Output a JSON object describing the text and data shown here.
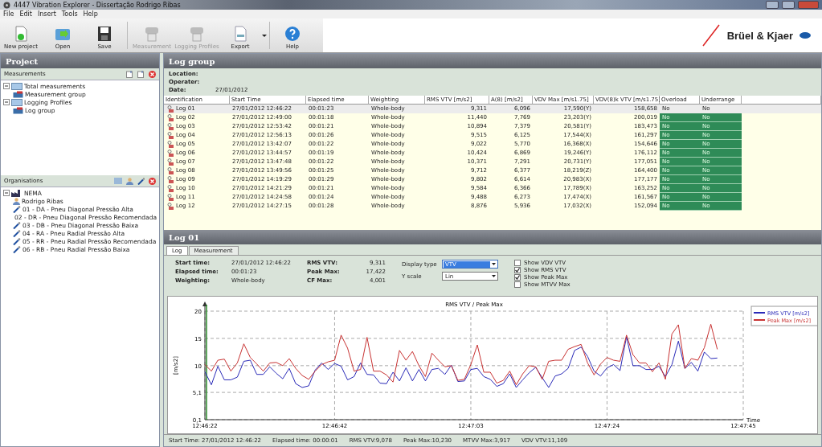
{
  "window": {
    "title": "4447 Vibration Explorer - Dissertação Rodrigo Ribas"
  },
  "menu": [
    "File",
    "Edit",
    "Insert",
    "Tools",
    "Help"
  ],
  "toolbar": [
    {
      "label": "New project",
      "kind": "new",
      "disabled": false
    },
    {
      "label": "Open",
      "kind": "open",
      "disabled": false
    },
    {
      "label": "Save",
      "kind": "save",
      "disabled": false
    },
    {
      "label": "Measurement",
      "kind": "device",
      "disabled": true
    },
    {
      "label": "Logging Profiles",
      "kind": "device",
      "disabled": true
    },
    {
      "label": "Export",
      "kind": "export",
      "disabled": false
    },
    {
      "label": "Help",
      "kind": "help",
      "disabled": false
    }
  ],
  "brand": "Brüel & Kjaer",
  "project": {
    "title": "Project",
    "measurements": {
      "title": "Measurements",
      "items": [
        {
          "label": "Total measurements",
          "kind": "folder",
          "expanded": true,
          "children": [
            {
              "label": "Measurement group",
              "kind": "group"
            }
          ]
        },
        {
          "label": "Logging Profiles",
          "kind": "folder",
          "expanded": true,
          "children": [
            {
              "label": "Log group",
              "kind": "group"
            }
          ]
        }
      ]
    },
    "organisations": {
      "title": "Organisations",
      "items": [
        {
          "label": "NEMA",
          "kind": "org",
          "expanded": true,
          "children": [
            {
              "label": "Rodrigo Ribas",
              "kind": "person"
            },
            {
              "label": "01 - DA - Pneu Diagonal Pressão Alta",
              "kind": "tool"
            },
            {
              "label": "02 - DR - Pneu Diagonal Pressão Recomendada",
              "kind": "tool"
            },
            {
              "label": "03 - DB - Pneu Diagonal Pressão Baixa",
              "kind": "tool"
            },
            {
              "label": "04 - RA - Pneu Radial Pressão Alta",
              "kind": "tool"
            },
            {
              "label": "05 - RR - Pneu Radial Pressão Recomendada",
              "kind": "tool"
            },
            {
              "label": "06 - RB - Pneu Radial Pressão Baixa",
              "kind": "tool"
            }
          ]
        }
      ]
    }
  },
  "log_group": {
    "title": "Log group",
    "info": [
      {
        "label": "Location:"
      },
      {
        "label": "Operater:"
      },
      {
        "label": "Date:",
        "value": "27/01/2012"
      }
    ],
    "table": {
      "columns": [
        "Identification",
        "Start Time",
        "Elapsed time",
        "Weighting",
        "RMS VTV [m/s2]",
        "A(8) [m/s2]",
        "VDV Max [m/s1.75]",
        "VDV(8)k VTV [m/s1.75]",
        "Overload",
        "Underrange"
      ],
      "rows": [
        {
          "selected": true,
          "cells": [
            "Log 01",
            "27/01/2012 12:46:22",
            "00:01:23",
            "Whole-body",
            "9,311",
            "6,096",
            "17,590(Y)",
            "158,658",
            "No",
            "No"
          ]
        },
        {
          "selected": false,
          "cells": [
            "Log 02",
            "27/01/2012 12:49:00",
            "00:01:18",
            "Whole-body",
            "11,440",
            "7,769",
            "23,203(Y)",
            "200,019",
            "No",
            "No"
          ]
        },
        {
          "selected": false,
          "cells": [
            "Log 03",
            "27/01/2012 12:53:42",
            "00:01:21",
            "Whole-body",
            "10,894",
            "7,379",
            "20,581(Y)",
            "183,473",
            "No",
            "No"
          ]
        },
        {
          "selected": false,
          "cells": [
            "Log 04",
            "27/01/2012 12:56:13",
            "00:01:26",
            "Whole-body",
            "9,515",
            "6,125",
            "17,544(X)",
            "161,297",
            "No",
            "No"
          ]
        },
        {
          "selected": false,
          "cells": [
            "Log 05",
            "27/01/2012 13:42:07",
            "00:01:22",
            "Whole-body",
            "9,022",
            "5,770",
            "16,368(X)",
            "154,646",
            "No",
            "No"
          ]
        },
        {
          "selected": false,
          "cells": [
            "Log 06",
            "27/01/2012 13:44:57",
            "00:01:19",
            "Whole-body",
            "10,424",
            "6,869",
            "19,246(Y)",
            "176,112",
            "No",
            "No"
          ]
        },
        {
          "selected": false,
          "cells": [
            "Log 07",
            "27/01/2012 13:47:48",
            "00:01:22",
            "Whole-body",
            "10,371",
            "7,291",
            "20,731(Y)",
            "177,051",
            "No",
            "No"
          ]
        },
        {
          "selected": false,
          "cells": [
            "Log 08",
            "27/01/2012 13:49:56",
            "00:01:25",
            "Whole-body",
            "9,712",
            "6,377",
            "18,219(Z)",
            "164,400",
            "No",
            "No"
          ]
        },
        {
          "selected": false,
          "cells": [
            "Log 09",
            "27/01/2012 14:19:29",
            "00:01:29",
            "Whole-body",
            "9,802",
            "6,614",
            "20,983(X)",
            "177,177",
            "No",
            "No"
          ]
        },
        {
          "selected": false,
          "cells": [
            "Log 10",
            "27/01/2012 14:21:29",
            "00:01:21",
            "Whole-body",
            "9,584",
            "6,366",
            "17,789(X)",
            "163,252",
            "No",
            "No"
          ]
        },
        {
          "selected": false,
          "cells": [
            "Log 11",
            "27/01/2012 14:24:58",
            "00:01:24",
            "Whole-body",
            "9,488",
            "6,273",
            "17,474(X)",
            "161,567",
            "No",
            "No"
          ]
        },
        {
          "selected": false,
          "cells": [
            "Log 12",
            "27/01/2012 14:27:15",
            "00:01:28",
            "Whole-body",
            "8,876",
            "5,936",
            "17,032(X)",
            "152,094",
            "No",
            "No"
          ]
        }
      ]
    }
  },
  "log": {
    "title": "Log 01",
    "tabs": [
      {
        "label": "Log",
        "selected": true
      },
      {
        "label": "Measurement",
        "selected": false
      }
    ],
    "info": [
      {
        "label": "Start time:",
        "value": "27/01/2012 12:46:22"
      },
      {
        "label": "Elapsed time:",
        "value": "00:01:23"
      },
      {
        "label": "Weighting:",
        "value": "Whole-body"
      }
    ],
    "values": [
      {
        "label": "RMS VTV:",
        "value": "9,311"
      },
      {
        "label": "Peak Max:",
        "value": "17,422"
      },
      {
        "label": "CF Max:",
        "value": "4,001"
      }
    ],
    "selects": [
      {
        "label": "Display type",
        "value": "VTV",
        "focused": true
      },
      {
        "label": "Y scale",
        "value": "Lin",
        "focused": false
      }
    ],
    "checks": [
      {
        "label": "Show VDV VTV",
        "checked": false
      },
      {
        "label": "Show RMS VTV",
        "checked": true
      },
      {
        "label": "Show Peak Max",
        "checked": true
      },
      {
        "label": "Show MTVV Max",
        "checked": false
      }
    ],
    "chart_data": {
      "type": "line",
      "grid": true,
      "legend": "upper right",
      "title": "RMS VTV / Peak Max",
      "xlabel": "Time",
      "ylabel": "[m/s2]",
      "x": [
        45982,
        45983,
        45984,
        45985,
        45986,
        45987,
        45988,
        45989,
        45990,
        45991,
        45992,
        45993,
        45994,
        45995,
        45996,
        45997,
        45998,
        45999,
        46000,
        46001,
        46002,
        46003,
        46004,
        46005,
        46006,
        46007,
        46008,
        46009,
        46010,
        46011,
        46012,
        46013,
        46014,
        46015,
        46016,
        46017,
        46018,
        46019,
        46020,
        46021,
        46022,
        46023,
        46024,
        46025,
        46026,
        46027,
        46028,
        46029,
        46030,
        46031,
        46032,
        46033,
        46034,
        46035,
        46036,
        46037,
        46038,
        46039,
        46040,
        46041,
        46042,
        46043,
        46044,
        46045,
        46046,
        46047,
        46048,
        46049,
        46050,
        46051,
        46052,
        46053,
        46054,
        46055,
        46056,
        46057,
        46058,
        46059,
        46060,
        46061
      ],
      "xlim": [
        45982,
        46065
      ],
      "ylim": [
        0.1,
        20
      ],
      "xticks": [
        {
          "value": 45982,
          "label": "12:46:22"
        },
        {
          "value": 46002,
          "label": "12:46:42"
        },
        {
          "value": 46023,
          "label": "12:47:03"
        },
        {
          "value": 46044,
          "label": "12:47:24"
        },
        {
          "value": 46065,
          "label": "12:47:45"
        }
      ],
      "yticks": [
        {
          "value": 0.1,
          "label": "0,1"
        },
        {
          "value": 5.1,
          "label": "5,1"
        },
        {
          "value": 10,
          "label": "10"
        },
        {
          "value": 15,
          "label": "15"
        },
        {
          "value": 20,
          "label": "20"
        }
      ],
      "series": [
        {
          "name": "RMS VTV [m/s2]",
          "color": "#2a2ab8",
          "values": [
            8.9,
            6.5,
            9.9,
            7.4,
            7.4,
            7.9,
            10.8,
            11,
            8.4,
            8.4,
            9.8,
            8.6,
            7.6,
            9.5,
            6.7,
            6,
            6.3,
            9.2,
            10.5,
            9.3,
            10.4,
            9.9,
            7.4,
            8,
            10.5,
            8.4,
            8.3,
            6.8,
            6.7,
            8.8,
            7.2,
            9.6,
            7.2,
            9.3,
            7.2,
            9.3,
            9.5,
            8.4,
            10.1,
            7.1,
            7.2,
            9.3,
            9.5,
            8,
            7.5,
            6.2,
            6.7,
            8.5,
            6,
            7.4,
            8.7,
            9.7,
            7.8,
            6,
            8.1,
            8.5,
            9.5,
            12.8,
            13.4,
            11.7,
            9,
            8.1,
            9.6,
            10.2,
            9.1,
            15.3,
            10,
            10,
            9.3,
            9.3,
            9.9,
            8,
            10.2,
            14.5,
            9.5,
            10.6,
            9,
            12.5,
            11.3,
            11.4
          ]
        },
        {
          "name": "Peak Max [m/s2]",
          "color": "#c83232",
          "values": [
            10.2,
            9,
            11,
            11.2,
            9,
            10.5,
            14,
            11.5,
            10.3,
            9,
            10.5,
            10.6,
            10,
            11.3,
            9.5,
            8.2,
            7.5,
            9,
            10.2,
            10.7,
            11,
            15.6,
            13.2,
            9,
            9.3,
            15.2,
            9,
            9,
            8.3,
            7,
            12.8,
            11,
            12.6,
            10,
            8,
            12.3,
            11,
            9.8,
            10,
            7.3,
            7.5,
            10.2,
            13.8,
            8.8,
            8.8,
            6.8,
            7.3,
            9,
            6.5,
            8.5,
            10,
            9.8,
            7.5,
            10.8,
            11,
            11,
            13,
            13.5,
            13.9,
            10.5,
            8.3,
            10.3,
            11.5,
            11,
            10.8,
            15.6,
            12,
            10.5,
            10.5,
            8.9,
            10.5,
            7.5,
            15.8,
            17.5,
            9.5,
            11.3,
            11,
            13.3,
            17.6,
            13
          ]
        }
      ]
    },
    "status": [
      "Start Time: 27/01/2012 12:46:22",
      "Elapsed time: 00:00:01",
      "RMS VTV:9,078",
      "Peak Max:10,230",
      "MTVV Max:3,917",
      "VDV VTV:11,109"
    ]
  }
}
